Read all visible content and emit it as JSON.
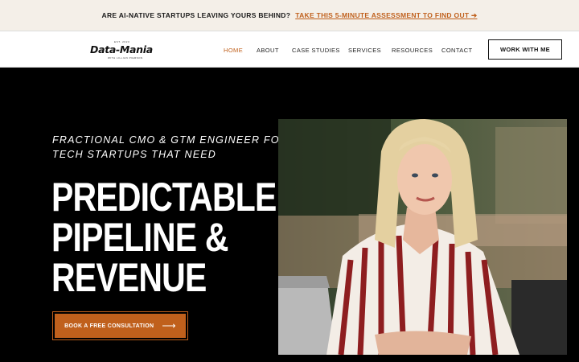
{
  "announcement": {
    "text": "ARE AI-NATIVE STARTUPS LEAVING YOURS BEHIND?",
    "link": "TAKE THIS 5-MINUTE ASSESSMENT TO FIND OUT ➔"
  },
  "logo": {
    "tagline_top": "EST. 2023",
    "wordmark": "Data-Mania",
    "tagline_bottom": "WITH LILLIAN PIERSON"
  },
  "nav": {
    "items": [
      {
        "label": "HOME",
        "active": true
      },
      {
        "label": "ABOUT"
      },
      {
        "label": "CASE STUDIES"
      },
      {
        "label": "SERVICES"
      },
      {
        "label": "RESOURCES"
      },
      {
        "label": "CONTACT"
      }
    ],
    "cta": "WORK WITH ME"
  },
  "hero": {
    "eyebrow": "FRACTIONAL CMO & GTM ENGINEER FOR TECH STARTUPS THAT NEED",
    "headline_lines": [
      "PREDICTABLE",
      "PIPELINE &",
      "REVENUE"
    ],
    "cta": "BOOK A FREE CONSULTATION",
    "cta_icon": "arrow-right-icon"
  },
  "colors": {
    "accent": "#c0601c",
    "announce_bg": "#f4efe8",
    "hero_bg": "#000000"
  }
}
